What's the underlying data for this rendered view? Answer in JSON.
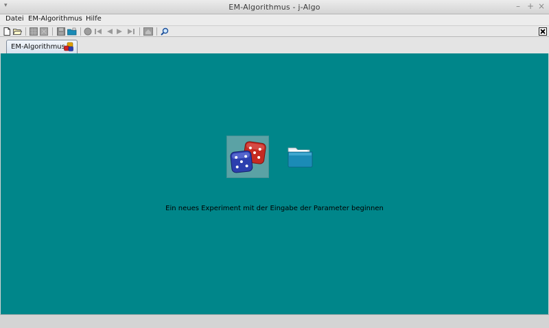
{
  "window": {
    "title": "EM-Algorithmus  -  j-Algo",
    "controls": {
      "minimize": "–",
      "maximize": "+",
      "close": "×"
    }
  },
  "menu": {
    "items": [
      {
        "label": "Datei"
      },
      {
        "label": "EM-Algorithmus"
      },
      {
        "label": "Hilfe"
      }
    ]
  },
  "toolbar": {
    "icons": [
      "new-document-icon",
      "open-folder-icon",
      "grid-icon",
      "grid-disabled-icon",
      "save-icon",
      "open-module-icon",
      "record-icon",
      "first-step-icon",
      "step-back-icon",
      "step-forward-icon",
      "last-step-icon",
      "home-icon",
      "zoom-icon",
      "close-module-icon"
    ]
  },
  "tabs": [
    {
      "label": "EM-Algorithmus"
    }
  ],
  "main": {
    "hint": "Ein neues Experiment mit der Eingabe der Parameter beginnen",
    "background": "#00868a"
  },
  "colors": {
    "accent": "#00868a",
    "dice_red": "#c62a22",
    "dice_blue": "#2c3fae",
    "folder": "#1b8bb6"
  }
}
